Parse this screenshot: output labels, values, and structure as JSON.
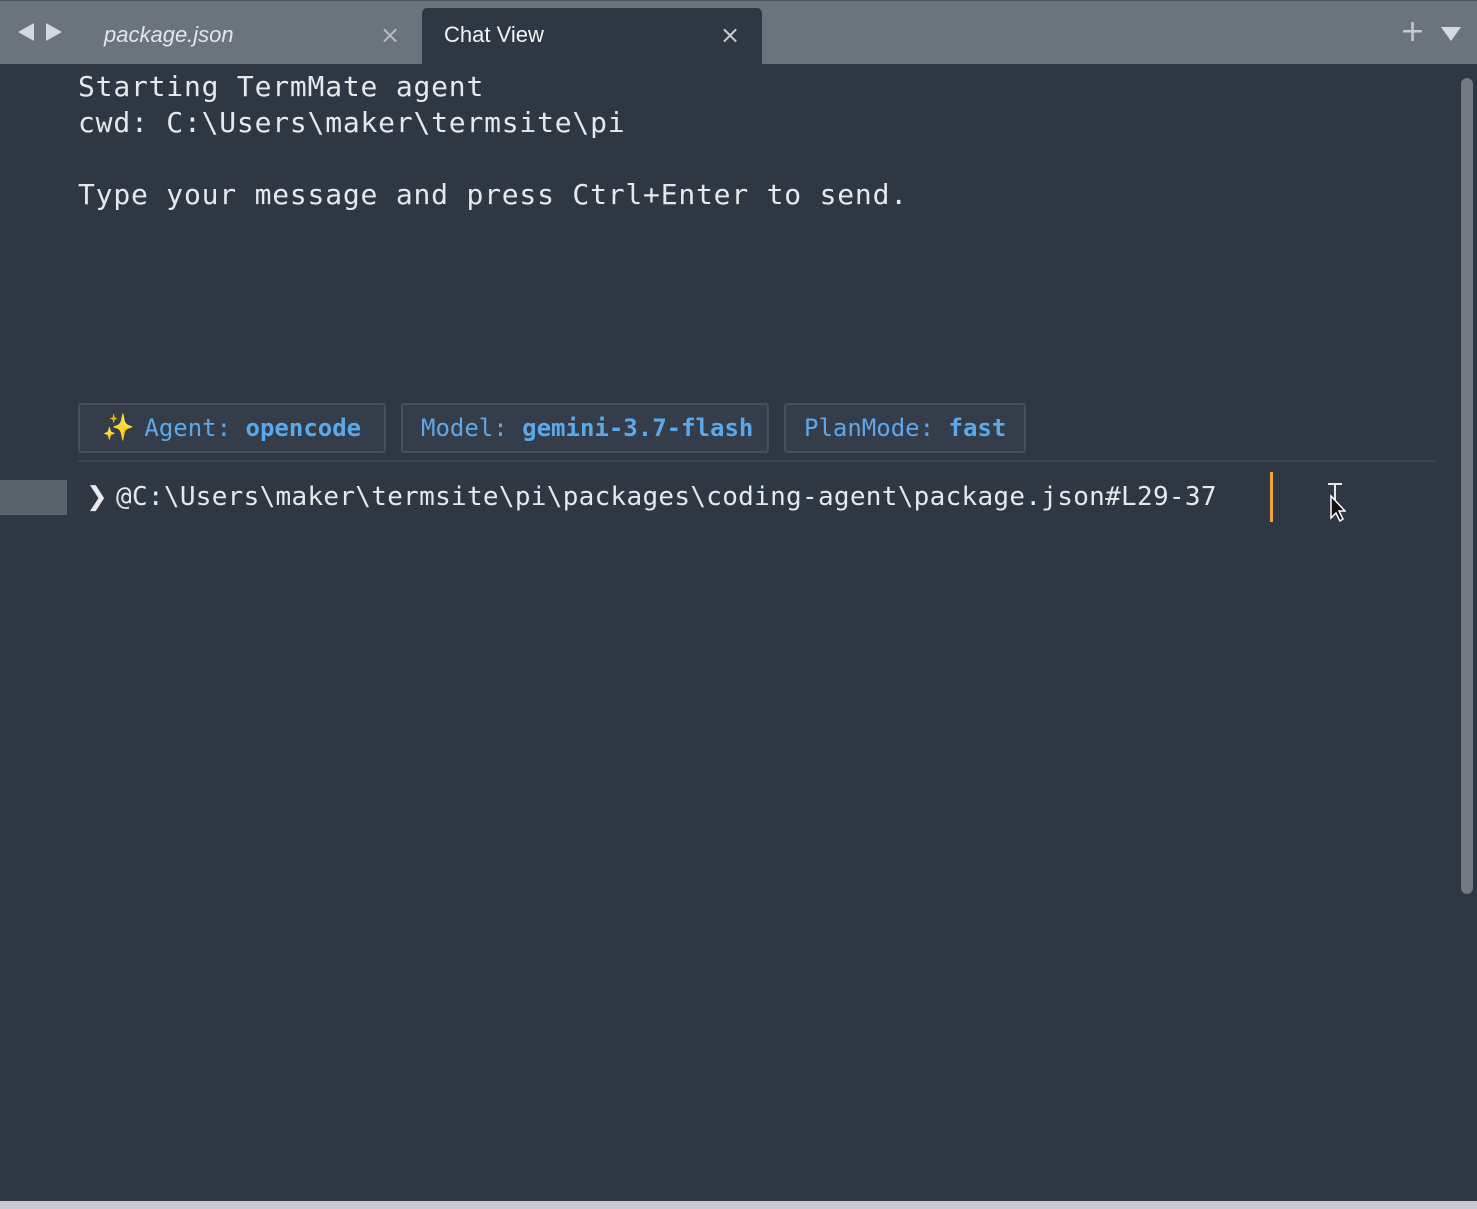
{
  "tabs": [
    {
      "label": "package.json",
      "active": false
    },
    {
      "label": "Chat View",
      "active": true
    }
  ],
  "icons": {
    "close": "×",
    "new_tab": "+",
    "prompt": "❯",
    "sparkle": "✨"
  },
  "terminal": {
    "lines": [
      "Starting TermMate agent",
      "cwd: C:\\Users\\maker\\termsite\\pi",
      "Type your message and press Ctrl+Enter to send."
    ]
  },
  "status_chips": {
    "agent": {
      "key": "Agent:",
      "value": "opencode"
    },
    "model": {
      "key": "Model:",
      "value": "gemini-3.7-flash"
    },
    "plan_mode": {
      "key": "PlanMode:",
      "value": "fast"
    }
  },
  "prompt": {
    "input_value": "@C:\\Users\\maker\\termsite\\pi\\packages\\coding-agent\\package.json#L29-37"
  },
  "colors": {
    "background": "#2f3742",
    "tab_bar": "#6b737d",
    "accent_blue": "#5aa9ec",
    "caret": "#f0a23a",
    "sparkle": "#f2c94c"
  }
}
